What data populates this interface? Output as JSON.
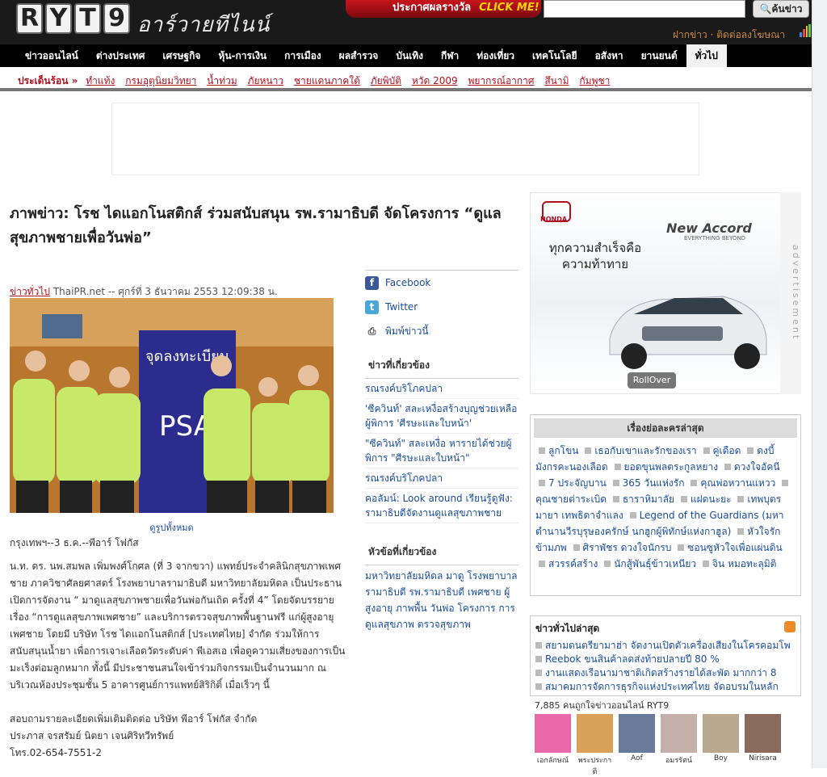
{
  "header": {
    "logo_letters": [
      "R",
      "Y",
      "T",
      "9"
    ],
    "logo_sub": "อาร์วายทีไนน์",
    "promo_text": "ประกาศผลรางวัล",
    "promo_click": "CLICK ME!",
    "search_button": "ค้นข่าว",
    "link_post": "ฝากข่าว",
    "link_ads": "ติดต่อลงโฆษณา"
  },
  "nav": [
    "ข่าวออนไลน์",
    "ต่างประเทศ",
    "เศรษฐกิจ",
    "หุ้น-การเงิน",
    "การเมือง",
    "ผลสำรวจ",
    "บันเทิง",
    "กีฬา",
    "ท่องเที่ยว",
    "เทคโนโลยี",
    "อสังหา",
    "ยานยนต์",
    "ทั่วไป"
  ],
  "hot": {
    "label": "ประเด็นร้อน »",
    "items": [
      "ทำแท้ง",
      "กรมอุตุนิยมวิทยา",
      "น้ำท่วม",
      "ภัยหนาว",
      "ชายแดนภาคใต้",
      "ภัยพิบัติ",
      "หวัด 2009",
      "พยากรณ์อากาศ",
      "สึนามิ",
      "กัมพูชา"
    ]
  },
  "article": {
    "title": "ภาพข่าว: โรช ไดแอกโนสติกส์ ร่วมสนับสนุน รพ.รามาธิบดี จัดโครงการ “ดูแลสุขภาพชายเพื่อวันพ่อ”",
    "category": "ข่าวทั่วไป",
    "source_date": "ThaiPR.net -- ศุกร์ที่ 3 ธันวาคม 2553 12:09:38 น.",
    "photo_caption": "ดูรูปทั้งหมด",
    "dateline": "กรุงเทพฯ--3 ธ.ค.--พีอาร์ โฟกัส",
    "body": "น.ท. ดร. นพ.สมพล เพิ่มพงศ์โกศล (ที่ 3 จากขวา) แพทย์ประจำคลินิกสุขภาพเพศชาย ภาควิชาศัลยศาสตร์ โรงพยาบาลรามาธิบดี มหาวิทยาลัยมหิดล เป็นประธานเปิดการจัดงาน “ มาดูแลสุขภาพชายเพื่อวันพ่อกันเถิด ครั้งที่ 4” โดยจัดบรรยายเรื่อง “การดูแลสุขภาพเพศชาย” และบริการตรวจสุขภาพพื้นฐานฟรี แก่ผู้สูงอายุเพศชาย โดยมี บริษัท โรช ไดแอกโนสติกส์ [ประเทศไทย] จำกัด ร่วมให้การสนับสนุนน้ำยา เพื่อการเจาะเลือดวัดระดับค่า พีเอสเอ เพื่อดูความเสี่ยงของการเป็นมะเร็งต่อมลูกหมาก ทั้งนี้ มีประชาชนสนใจเข้าร่วมกิจกรรมเป็นจำนวนมาก ณ บริเวณห้องประชุมชั้น 5 อาคารศูนย์การแพทย์สิริกิติ์ เมื่อเร็วๆ นี้",
    "contact_1": "สอบถามรายละเอียดเพิ่มเติมติดต่อ บริษัท พีอาร์ โฟกัส จำกัด",
    "contact_2": "ประภาส จรสรัมย์ นิตยา เจนศิริทวีทรัพย์",
    "contact_3": "โทร.02-654-7551-2",
    "photo_banner": "จุดลงทะเบียน",
    "photo_banner2": "PSA"
  },
  "share": {
    "facebook": "Facebook",
    "twitter": "Twitter",
    "print": "พิมพ์ข่าวนี้"
  },
  "related": {
    "heading": "ข่าวที่เกี่ยวข้อง",
    "items": [
      "รณรงค์บริโภคปลา",
      "'ซีควินท์' สละเหงื่อสร้างบุญช่วยเหลือผู้พิการ 'ศีรษะและใบหน้า'",
      "\"ซีควินท์\" สละเหงื่อ หารายได้ช่วยผู้พิการ \"ศีรษะและใบหน้า\"",
      "รณรงค์บริโภคปลา",
      "คอลัมน์: Look around เรียนรู้ดูฟัง: รามาธิบดีจัดงานดูแลสุขภาพชาย"
    ]
  },
  "topics": {
    "heading": "หัวข้อที่เกี่ยวข้อง",
    "text": "มหาวิทยาลัยมหิดล มาดู โรงพยาบาลรามาธิบดี รพ.รามาธิบดี เพศชาย ผู้สูงอายุ ภาพพื้น วันพ่อ โครงการ การดูแลสุขภาพ ตรวจสุขภาพ"
  },
  "ad": {
    "brand": "HONDA",
    "tagline": "ทุกความสำเร็จคือ",
    "tagline2": "ความท้าทาย",
    "model": "New Accord",
    "model_sub": "EVERYTHING BEYOND",
    "rollover": "RollOver",
    "vertical": "advertisement"
  },
  "latest_stories": {
    "heading": "เรื่องย่อละครล่าสุด",
    "items": [
      "ลูกโขน",
      "เธอกับเขาและรักของเรา",
      "คู่เดือด",
      "ดงบี้มังกรคะนองเลือด",
      "ยอดขุนพลตระกูลหยาง",
      "ดวงใจอัคนี",
      "7 ประจัญบาน",
      "365 วันแห่งรัก",
      "คุณพ่อหวานแหวว",
      "คุณชายต่าระเบิด",
      "ธาราหิมาลัย",
      "แฝดนะยะ",
      "เทพบุตรมายา เทพธิดาจำแลง",
      "Legend of the Guardians (มหาตำนานวีรบุรุษองครักษ์ นกฮูกผู้พิทักษ์แห่งกาฮูล)",
      "หัวใจรักข้ามภพ",
      "ศิราพัชร ดวงใจนักรบ",
      "ซอนซูหัวใจเพื่อแผ่นดิน",
      "สวรรค์สร้าง",
      "นักสู้พันธุ์ข้าวเหนียว",
      "จิน หมอทะลุมิติ"
    ]
  },
  "general_news": {
    "heading": "ข่าวทั่วไปล่าสุด",
    "items": [
      "สยามดนตรียามาฮ่า จัดงานเปิดตัวเครื่องเสียงในโครคอมโพ",
      "Reebok ขนสินค้าลดส่งท้ายปลายปี 80 %",
      "งานแสดงเรือนามาชาติเกิดสร้างรายได้สะพัด มากกว่า 8",
      "สมาคมการจัดการธุรกิจแห่งประเทศไทย จัดอบรมในหลัก"
    ]
  },
  "fans": {
    "count": "7,885 คนถูกใจข่าวออนไลน์ RYT9",
    "names": [
      "เอกลักษณ์",
      "พระประกาติ",
      "Aof",
      "อมรรัตน์",
      "Boy",
      "Nirisara"
    ]
  },
  "colors": {
    "accent_red": "#b01020",
    "link_blue": "#1a4c9c",
    "nav_bg": "#000000"
  }
}
